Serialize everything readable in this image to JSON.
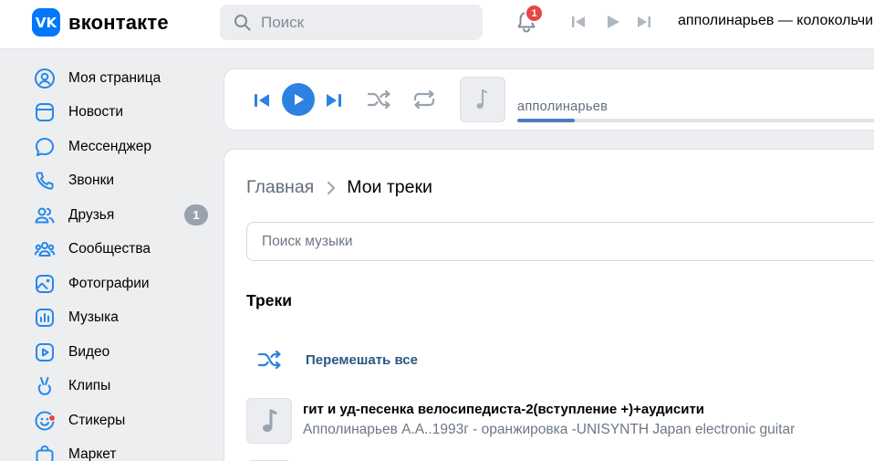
{
  "header": {
    "logo_badge": "VK",
    "logo_text": "вконтакте",
    "search_placeholder": "Поиск",
    "notifications_count": "1",
    "now_playing": "апполинарьев — колокольчики"
  },
  "sidebar": {
    "items": [
      {
        "label": "Моя страница",
        "icon": "user-circle-icon"
      },
      {
        "label": "Новости",
        "icon": "newsfeed-icon"
      },
      {
        "label": "Мессенджер",
        "icon": "message-icon"
      },
      {
        "label": "Звонки",
        "icon": "phone-icon"
      },
      {
        "label": "Друзья",
        "icon": "friends-icon",
        "badge": "1"
      },
      {
        "label": "Сообщества",
        "icon": "communities-icon"
      },
      {
        "label": "Фотографии",
        "icon": "photo-icon"
      },
      {
        "label": "Музыка",
        "icon": "music-icon"
      },
      {
        "label": "Видео",
        "icon": "video-icon"
      },
      {
        "label": "Клипы",
        "icon": "clips-icon"
      },
      {
        "label": "Стикеры",
        "icon": "smile-icon"
      },
      {
        "label": "Маркет",
        "icon": "market-icon"
      }
    ]
  },
  "player": {
    "artist": "апполинарьев",
    "progress": 0.15
  },
  "content": {
    "breadcrumb_home": "Главная",
    "breadcrumb_current": "Мои треки",
    "search_placeholder": "Поиск музыки",
    "section_title": "Треки",
    "shuffle_all": "Перемешать все",
    "tracks": [
      {
        "title": "гит и уд-песенка велосипедиста-2(вступление +)+аудисити",
        "artist": "Апполинарьев А.А..1993г - оранжировка -UNISYNTH Japan electronic guitar"
      }
    ]
  },
  "colors": {
    "accent": "#0077ff",
    "player_button": "#2d81e0",
    "link": "#2a5885",
    "badge_red": "#e64646",
    "icon_blue": "#2688eb"
  }
}
